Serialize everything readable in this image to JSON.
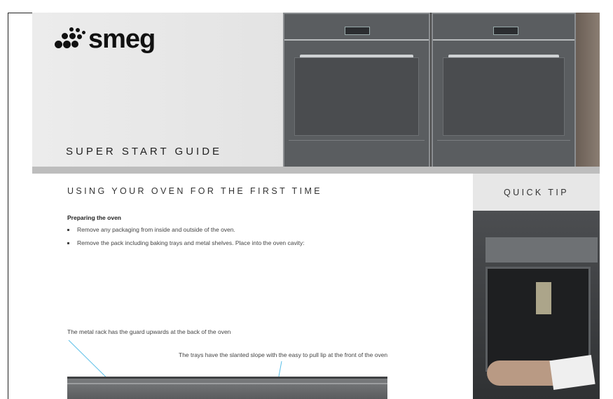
{
  "brand": {
    "logo_text": "smeg"
  },
  "hero": {
    "title": "SUPER START GUIDE"
  },
  "main": {
    "section_title": "USING YOUR OVEN FOR THE FIRST TIME",
    "subheading": "Preparing the oven",
    "bullets": [
      "Remove any packaging from inside and outside of the oven.",
      "Remove the pack including baking trays and metal shelves. Place into the oven cavity:"
    ],
    "captions": [
      "The metal rack has the guard upwards at the back of the oven",
      "The trays have the slanted slope with the easy to pull lip at the front of the oven"
    ]
  },
  "quick_tip": {
    "title": "QUICK TIP"
  },
  "colors": {
    "accent_line": "#5bbfe8",
    "tip_background": "#e7e7e7",
    "text": "#333333"
  }
}
